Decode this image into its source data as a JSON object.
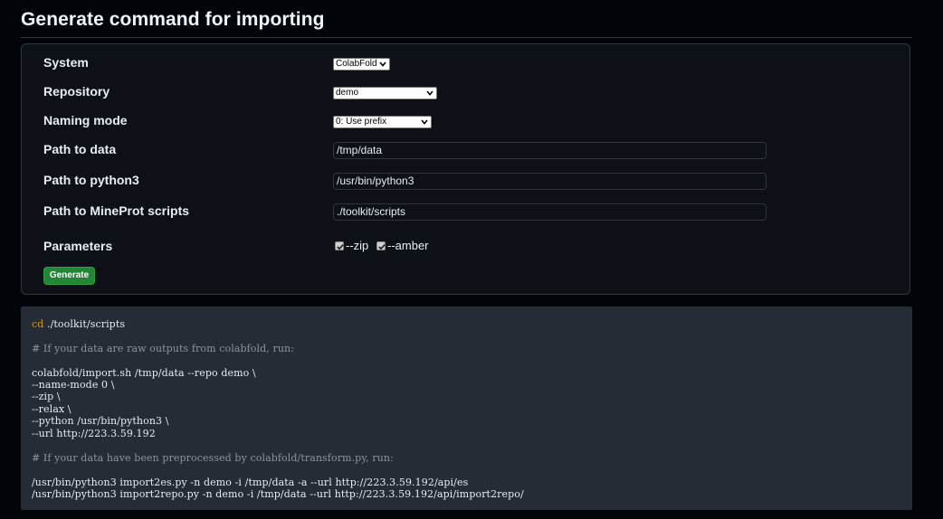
{
  "page": {
    "title": "Generate command for importing"
  },
  "form": {
    "system": {
      "label": "System",
      "value": "ColabFold"
    },
    "repository": {
      "label": "Repository",
      "value": "demo"
    },
    "naming_mode": {
      "label": "Naming mode",
      "value": "0: Use prefix"
    },
    "path_to_data": {
      "label": "Path to data",
      "value": "/tmp/data"
    },
    "path_to_python3": {
      "label": "Path to python3",
      "value": "/usr/bin/python3"
    },
    "path_to_scripts": {
      "label": "Path to MineProt scripts",
      "value": "./toolkit/scripts"
    },
    "parameters": {
      "label": "Parameters",
      "options": [
        {
          "label": "--zip",
          "checked": true
        },
        {
          "label": "--amber",
          "checked": true
        }
      ]
    },
    "generate_label": "Generate"
  },
  "output": {
    "cd_keyword": "cd",
    "cd_path": " ./toolkit/scripts",
    "comment_raw": "# If your data are raw outputs from colabfold, run:",
    "raw_lines": [
      "colabfold/import.sh /tmp/data --repo demo \\",
      "--name-mode 0 \\",
      "--zip \\",
      "--relax \\",
      "--python /usr/bin/python3 \\",
      "--url http://223.3.59.192"
    ],
    "comment_preprocessed": "# If your data have been preprocessed by colabfold/transform.py, run:",
    "pre_lines": [
      "/usr/bin/python3 import2es.py -n demo -i /tmp/data -a --url http://223.3.59.192/api/es",
      "/usr/bin/python3 import2repo.py -n demo -i /tmp/data --url http://223.3.59.192/api/import2repo/"
    ]
  },
  "colors": {
    "background": "#010409",
    "panel": "#0d1117",
    "code_panel": "#262c36",
    "accent_green": "#238636",
    "keyword": "#d29922",
    "comment": "#8b949e"
  },
  "icons": {
    "select_chevron": "chevron-down-icon",
    "checkbox_mark": "checkmark-icon"
  }
}
